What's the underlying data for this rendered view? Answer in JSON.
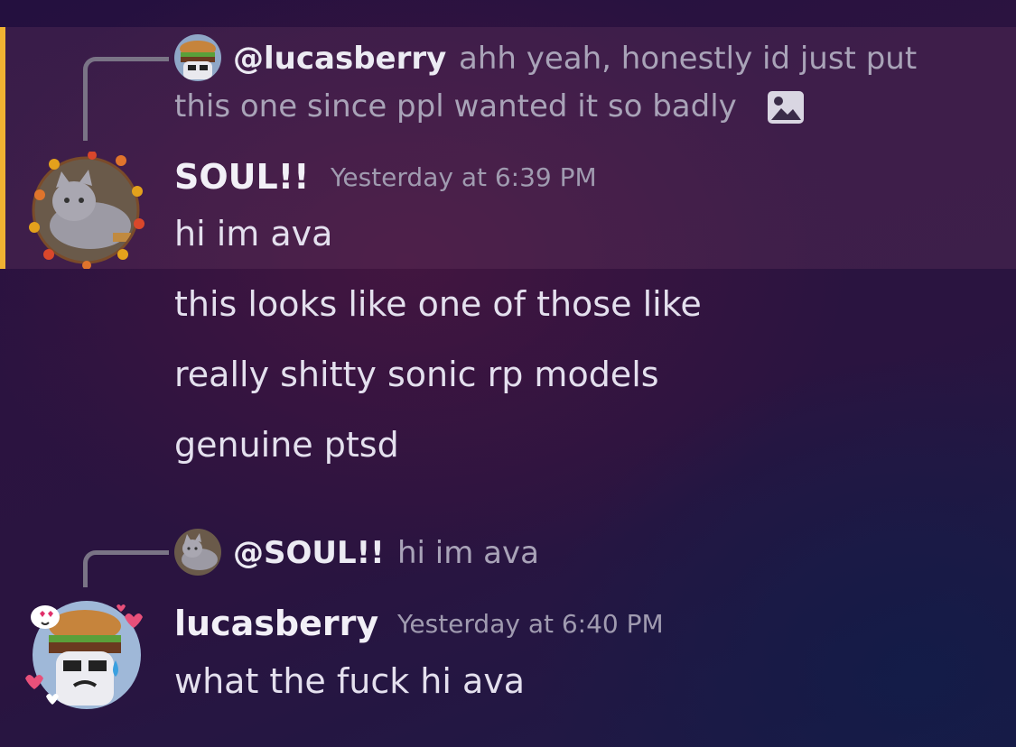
{
  "messages": [
    {
      "reply": {
        "mention": "@lucasberry",
        "preview_line1": "ahh yeah, honestly id just put",
        "preview_line2": "this one since ppl wanted it so badly"
      },
      "author": "SOUL!!",
      "timestamp": "Yesterday at 6:39 PM",
      "lines": [
        "hi im ava",
        "this looks like one of those like",
        "really shitty sonic rp models",
        "genuine ptsd"
      ],
      "highlighted": true
    },
    {
      "reply": {
        "mention": "@SOUL!!",
        "preview_line1": "hi im ava"
      },
      "author": "lucasberry",
      "timestamp": "Yesterday at 6:40 PM",
      "lines": [
        "what the fuck hi ava"
      ],
      "highlighted": false
    }
  ],
  "icons": {
    "image_attachment": "image-icon",
    "avatar_soul": "cat-plush-avatar",
    "avatar_lucasberry": "burger-avatar"
  },
  "colors": {
    "highlight_bar": "#f0b232",
    "text_primary": "#e4e0ee",
    "text_muted": "#a9a3b8"
  }
}
